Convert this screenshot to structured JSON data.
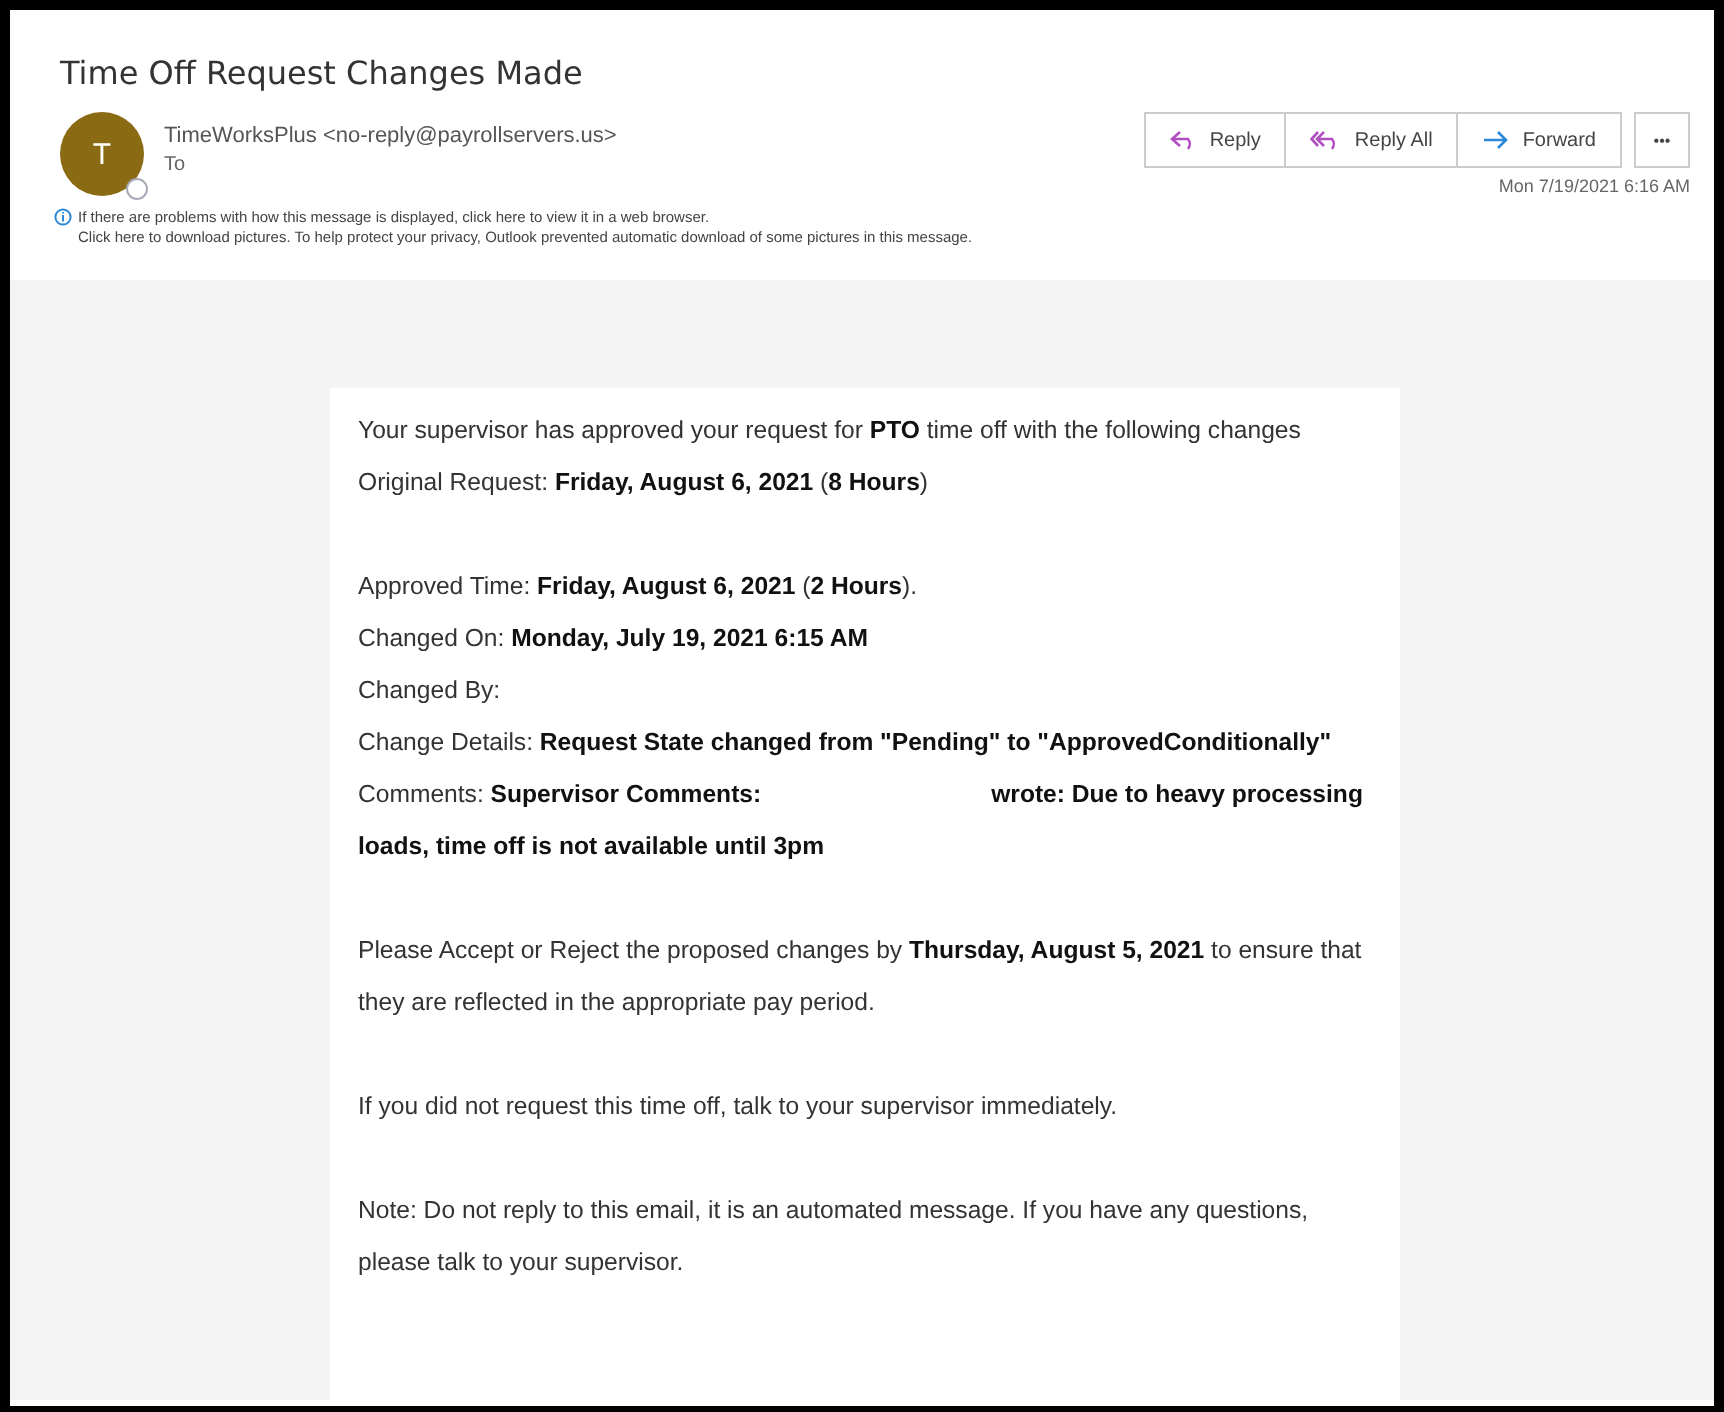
{
  "subject": "Time Off Request Changes Made",
  "sender": {
    "initial": "T",
    "from": "TimeWorksPlus <no-reply@payrollservers.us>",
    "to_label": "To"
  },
  "actions": [
    {
      "kind": "reply",
      "label": "Reply"
    },
    {
      "kind": "reply_all",
      "label": "Reply All"
    },
    {
      "kind": "forward",
      "label": "Forward"
    }
  ],
  "more_button": "•••",
  "date": "Mon 7/19/2021 6:16 AM",
  "info": [
    "If there are problems with how this message is displayed, click here to view it in a web browser.",
    "Click here to download pictures. To help protect your privacy, Outlook prevented automatic download of some pictures in this message."
  ],
  "body": [
    [
      "Your supervisor has approved your request for **PTO** time off with the following changes",
      "Original Request: **Friday, August 6, 2021** (**8 Hours**)"
    ],
    [
      "Approved Time: **Friday, August 6, 2021** (**2 Hours**).",
      "Changed On: **Monday, July 19, 2021 6:15 AM**",
      "Changed By:",
      "Change Details:  **Request State changed from \"Pending\" to \"ApprovedConditionally\"**"
    ],
    [
      "Please Accept or Reject the proposed changes by **Thursday, August 5, 2021** to ensure that they are reflected in the appropriate pay period."
    ],
    [
      "If you did not request this time off, talk to your supervisor immediately."
    ],
    [
      "Note: Do not reply to this email, it is an automated message. If you have any questions, please talk to your supervisor."
    ]
  ],
  "comment": {
    "label": "Comments:",
    "prefix": "Supervisor Comments:",
    "suffix": "wrote: Due to heavy processing loads, time off is not available until 3pm"
  }
}
